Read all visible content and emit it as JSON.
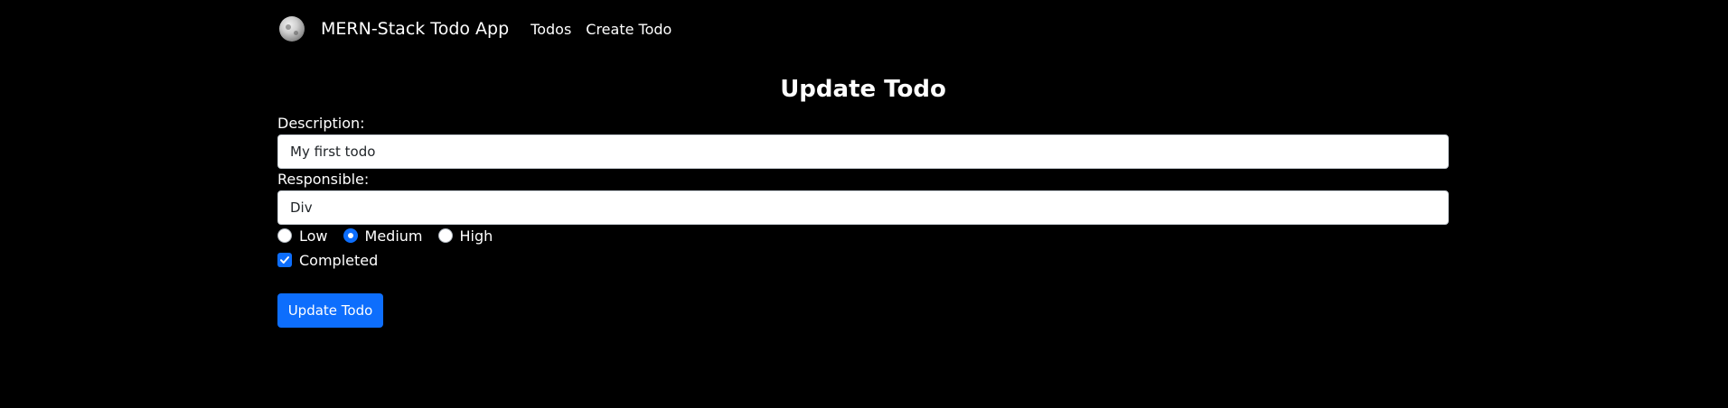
{
  "navbar": {
    "brand": "MERN-Stack Todo App",
    "links": [
      "Todos",
      "Create Todo"
    ],
    "logo_icon": "moon-icon"
  },
  "form": {
    "title": "Update Todo",
    "description_label": "Description:",
    "description_value": "My first todo",
    "responsible_label": "Responsible:",
    "responsible_value": "Div",
    "priority_options": [
      "Low",
      "Medium",
      "High"
    ],
    "priority_selected": "Medium",
    "completed_label": "Completed",
    "completed_checked": true,
    "submit_label": "Update Todo"
  },
  "colors": {
    "background": "#000000",
    "primary": "#0d6efd",
    "text": "#ffffff"
  }
}
